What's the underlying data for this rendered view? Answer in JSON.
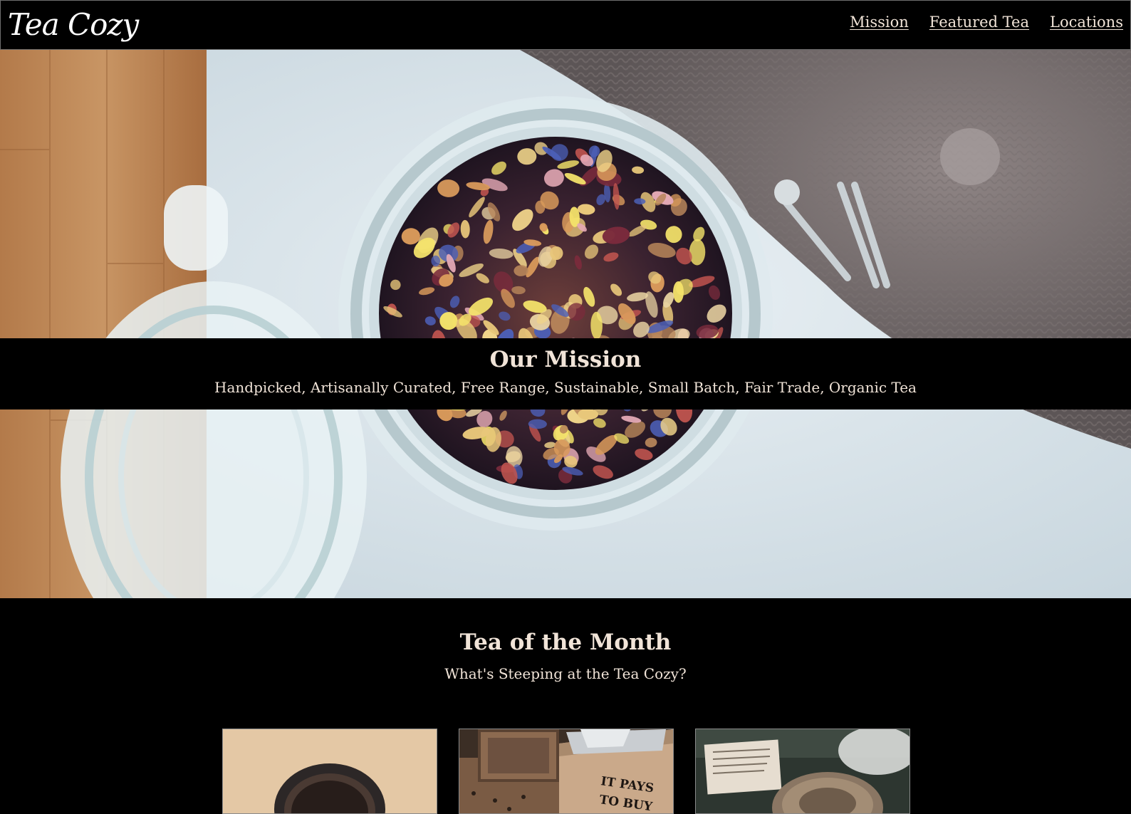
{
  "header": {
    "logo": "Tea Cozy",
    "nav": [
      {
        "label": "Mission"
      },
      {
        "label": "Featured Tea"
      },
      {
        "label": "Locations"
      }
    ]
  },
  "hero": {
    "image_icon": "tea-jar-hero-image"
  },
  "mission": {
    "title": "Our Mission",
    "subtitle": "Handpicked, Artisanally Curated, Free Range, Sustainable, Small Batch, Fair Trade, Organic Tea"
  },
  "tea_of_month": {
    "title": "Tea of the Month",
    "subtitle": "What's Steeping at the Tea Cozy?",
    "cards": [
      {
        "image_icon": "tea-cup-image"
      },
      {
        "image_icon": "tea-box-image",
        "box_text": "IT PAYS TO BUY"
      },
      {
        "image_icon": "tea-pastry-image"
      }
    ]
  },
  "colors": {
    "background": "#000000",
    "text": "#f1e4d8",
    "border": "#6e6e6e"
  }
}
